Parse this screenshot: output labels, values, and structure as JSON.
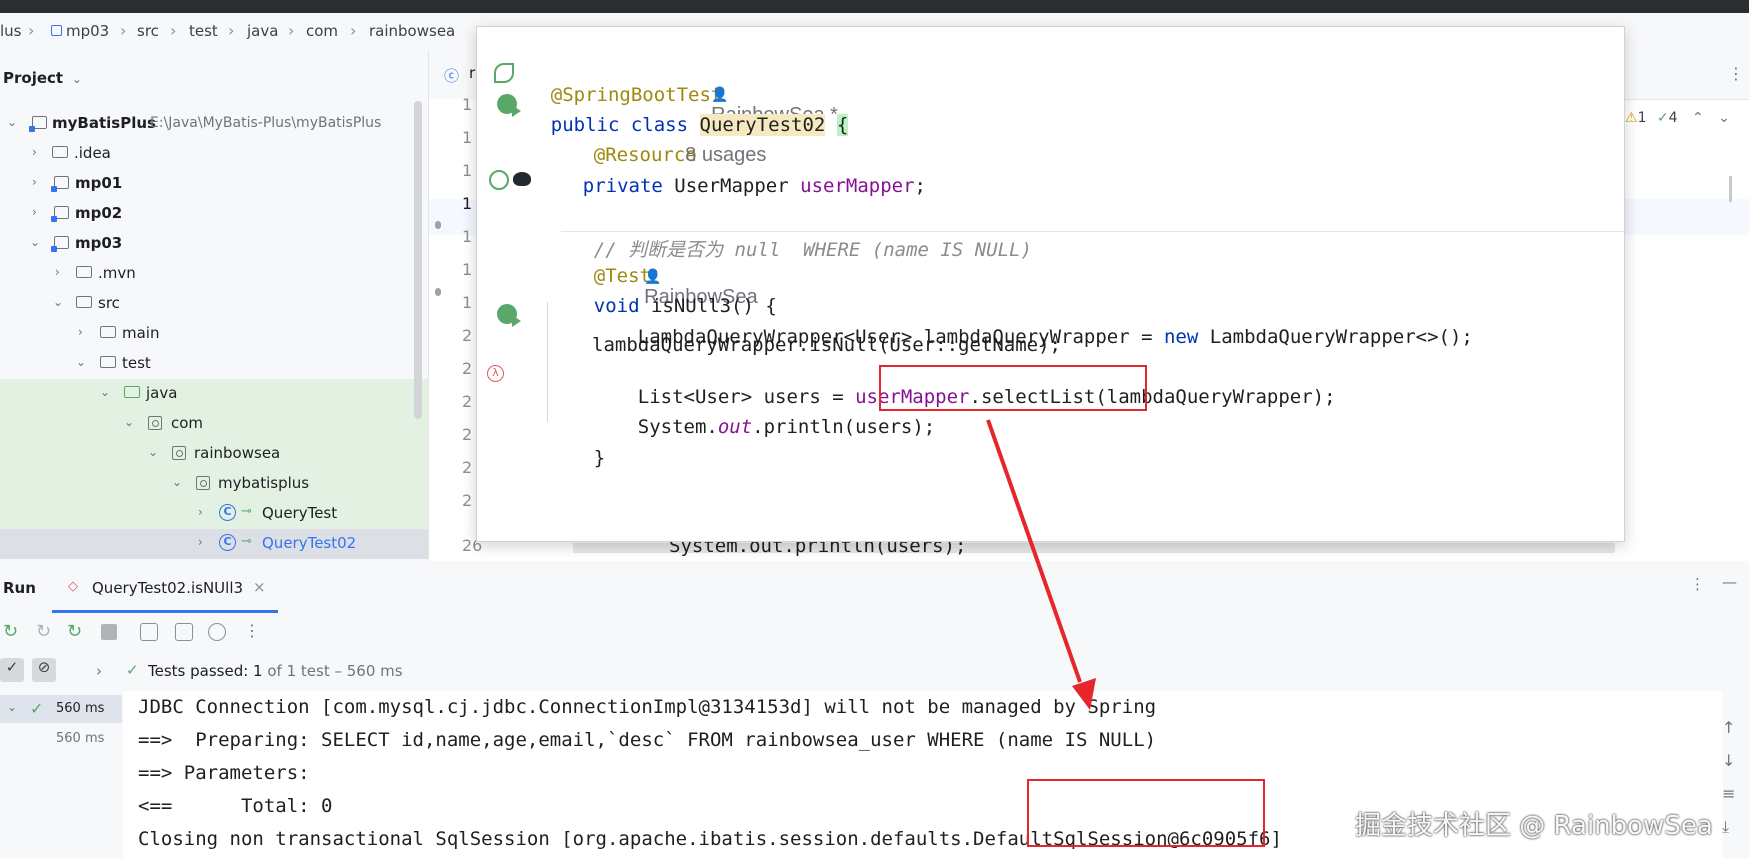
{
  "breadcrumb": [
    "lus",
    "mp03",
    "src",
    "test",
    "java",
    "com",
    "rainbowsea"
  ],
  "project": {
    "header": "Project",
    "root_name": "myBatisPlus",
    "root_path": "E:\\Java\\MyBatis-Plus\\myBatisPlus",
    "items": [
      {
        "label": ".idea"
      },
      {
        "label": "mp01"
      },
      {
        "label": "mp02"
      },
      {
        "label": "mp03"
      },
      {
        "label": ".mvn"
      },
      {
        "label": "src"
      },
      {
        "label": "main"
      },
      {
        "label": "test"
      },
      {
        "label": "java"
      },
      {
        "label": "com"
      },
      {
        "label": "rainbowsea"
      },
      {
        "label": "mybatisplus"
      },
      {
        "label": "QueryTest"
      },
      {
        "label": "QueryTest02"
      }
    ]
  },
  "editor": {
    "tab_partial": "r",
    "line_numbers": [
      "1",
      "1",
      "1",
      "1",
      "1",
      "1",
      "1",
      "2",
      "2",
      "2",
      "2",
      "2",
      "2",
      "26"
    ],
    "behind_line": "System.out.println(users);",
    "inspections": {
      "warnings": "1",
      "weak_warnings": "4"
    }
  },
  "popup": {
    "annotation": "@SpringBootTest",
    "author1": "RainbowSea *",
    "kw_public": "public",
    "kw_class": "class",
    "classname": "QueryTest02",
    "open_brace": "{",
    "resource": "@Resource",
    "usages": "8 usages",
    "kw_private": "private",
    "field_type": "UserMapper",
    "field_name": "userMapper",
    "semicolon": ";",
    "comment": "// 判断是否为 null  WHERE (name IS NULL)",
    "test_ann": "@Test",
    "author2": "RainbowSea",
    "method_sig_kw": "void",
    "method_sig": "isNUll3() {",
    "line1_a": "LambdaQueryWrapper",
    "line1_b": "<User>",
    "line1_c": " lambdaQueryWrapper = ",
    "line1_new": "new",
    "line1_d": " LambdaQueryWrapper<>();",
    "line2": "lambdaQueryWrapper.isNull(User::getName);",
    "line3_a": "List<User> users = ",
    "line3_field": "userMapper",
    "line3_b": ".selectList(lambdaQueryWrapper);",
    "line4_a": "System.",
    "line4_out": "out",
    "line4_b": ".println(users);",
    "close_brace": "}"
  },
  "run": {
    "title": "Run",
    "tab": "QueryTest02.isNUll3",
    "tests_passed_label": "Tests passed: ",
    "tests_passed_count": "1",
    "tests_passed_rest": " of 1 test – 560 ms",
    "tree_time1": "560 ms",
    "tree_time2": "560 ms",
    "console": [
      "JDBC Connection [com.mysql.cj.jdbc.ConnectionImpl@3134153d] will not be managed by Spring",
      "==>  Preparing: SELECT id,name,age,email,`desc` FROM rainbowsea_user WHERE (name IS NULL)",
      "==> Parameters: ",
      "<==      Total: 0",
      "Closing non transactional SqlSession [org.apache.ibatis.session.defaults.DefaultSqlSession@6c0905f6]"
    ]
  },
  "watermark": "掘金技术社区 @ RainbowSea",
  "colors": {
    "accent": "#3574f0",
    "annotation_red": "#e5262b",
    "highlight_green": "#e3f1e2"
  }
}
